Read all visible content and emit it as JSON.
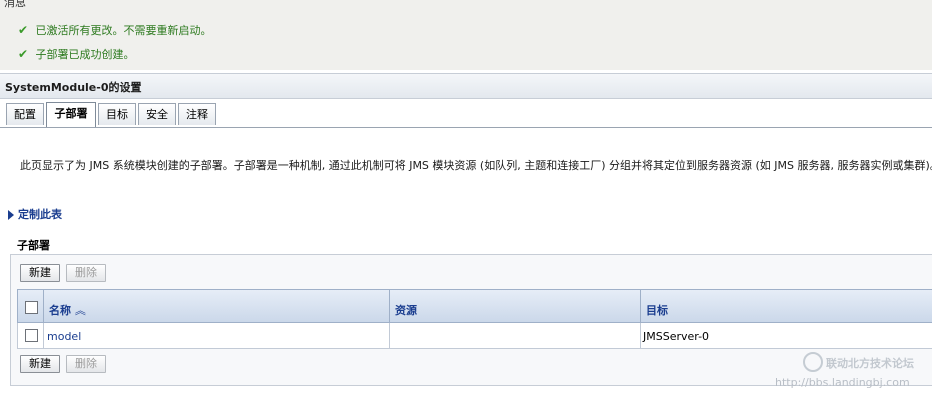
{
  "messages": {
    "header": "消息",
    "items": [
      {
        "icon": "check-icon",
        "text": "已激活所有更改。不需要重新启动。"
      },
      {
        "icon": "check-icon",
        "text": "子部署已成功创建。"
      }
    ]
  },
  "settings": {
    "title": "SystemModule-0的设置"
  },
  "tabs": [
    {
      "label": "配置",
      "active": false
    },
    {
      "label": "子部署",
      "active": true
    },
    {
      "label": "目标",
      "active": false
    },
    {
      "label": "安全",
      "active": false
    },
    {
      "label": "注释",
      "active": false
    }
  ],
  "description": "此页显示了为 JMS 系统模块创建的子部署。子部署是一种机制, 通过此机制可将 JMS 模块资源 (如队列, 主题和连接工厂) 分组并将其定位到服务器资源 (如 JMS 服务器, 服务器实例或集群)。",
  "customize_link": "定制此表",
  "subdeployments": {
    "section_title": "子部署",
    "new_button": "新建",
    "delete_button": "删除",
    "columns": [
      "名称",
      "资源",
      "目标"
    ],
    "sort_indicator": "sort-ascending-icon",
    "rows": [
      {
        "name": "model",
        "resources": "",
        "targets": "JMSServer-0"
      }
    ]
  },
  "watermark": {
    "title": "联动北方技术论坛",
    "url": "http://bbs.landingbj.com"
  },
  "colors": {
    "success_text": "#2d7a1f",
    "link": "#1a3d8f",
    "header_bg": "#cbd8ea"
  }
}
